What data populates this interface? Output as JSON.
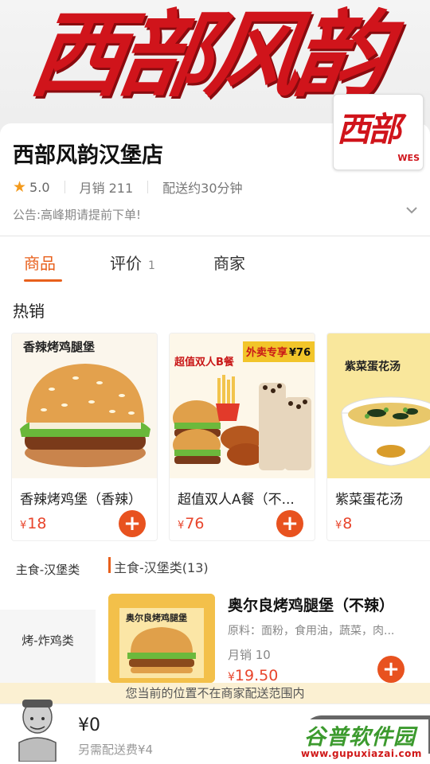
{
  "shop": {
    "name": "西部风韵汉堡店",
    "rating": "5.0",
    "monthly_sales": "月销 211",
    "delivery_time": "配送约30分钟",
    "notice": "公告:高峰期请提前下单!",
    "banner_text": "西部风韵",
    "logo_text": "西部",
    "logo_sub": "WES"
  },
  "tabs": [
    {
      "label": "商品"
    },
    {
      "label": "评价",
      "count": "1"
    },
    {
      "label": "商家"
    }
  ],
  "hot": {
    "title": "热销",
    "items": [
      {
        "name": "香辣烤鸡堡（香辣）",
        "price": "18",
        "image_caption": "香辣烤鸡腿堡"
      },
      {
        "name": "超值双人A餐（不...",
        "price": "76",
        "image_caption": "超值双人B餐",
        "image_badge": "外卖专享",
        "image_badge_price": "¥76"
      },
      {
        "name": "紫菜蛋花汤",
        "price": "8",
        "image_caption": "紫菜蛋花汤"
      }
    ]
  },
  "categories": [
    {
      "label": "主食-汉堡类",
      "active": true
    },
    {
      "label": "烤-炸鸡类",
      "active": false
    }
  ],
  "menu": {
    "category_title": "主食-汉堡类(13)",
    "dish": {
      "name": "奥尔良烤鸡腿堡（不辣）",
      "desc": "原料：面粉，食用油，蔬菜，肉...",
      "sales": "月销 10",
      "price": "19.50",
      "image_caption": "奥尔良烤鸡腿堡"
    }
  },
  "range_tip": "您当前的位置不在商家配送范围内",
  "cart": {
    "total": "¥0",
    "extra_fee": "另需配送费¥4"
  },
  "watermark": {
    "line1": "谷普软件园",
    "line2": "www.gupuxiazai.com"
  },
  "currency_symbol": "¥",
  "colors": {
    "accent": "#e8601c",
    "price": "#e8452c",
    "brand_red": "#d0141b"
  }
}
